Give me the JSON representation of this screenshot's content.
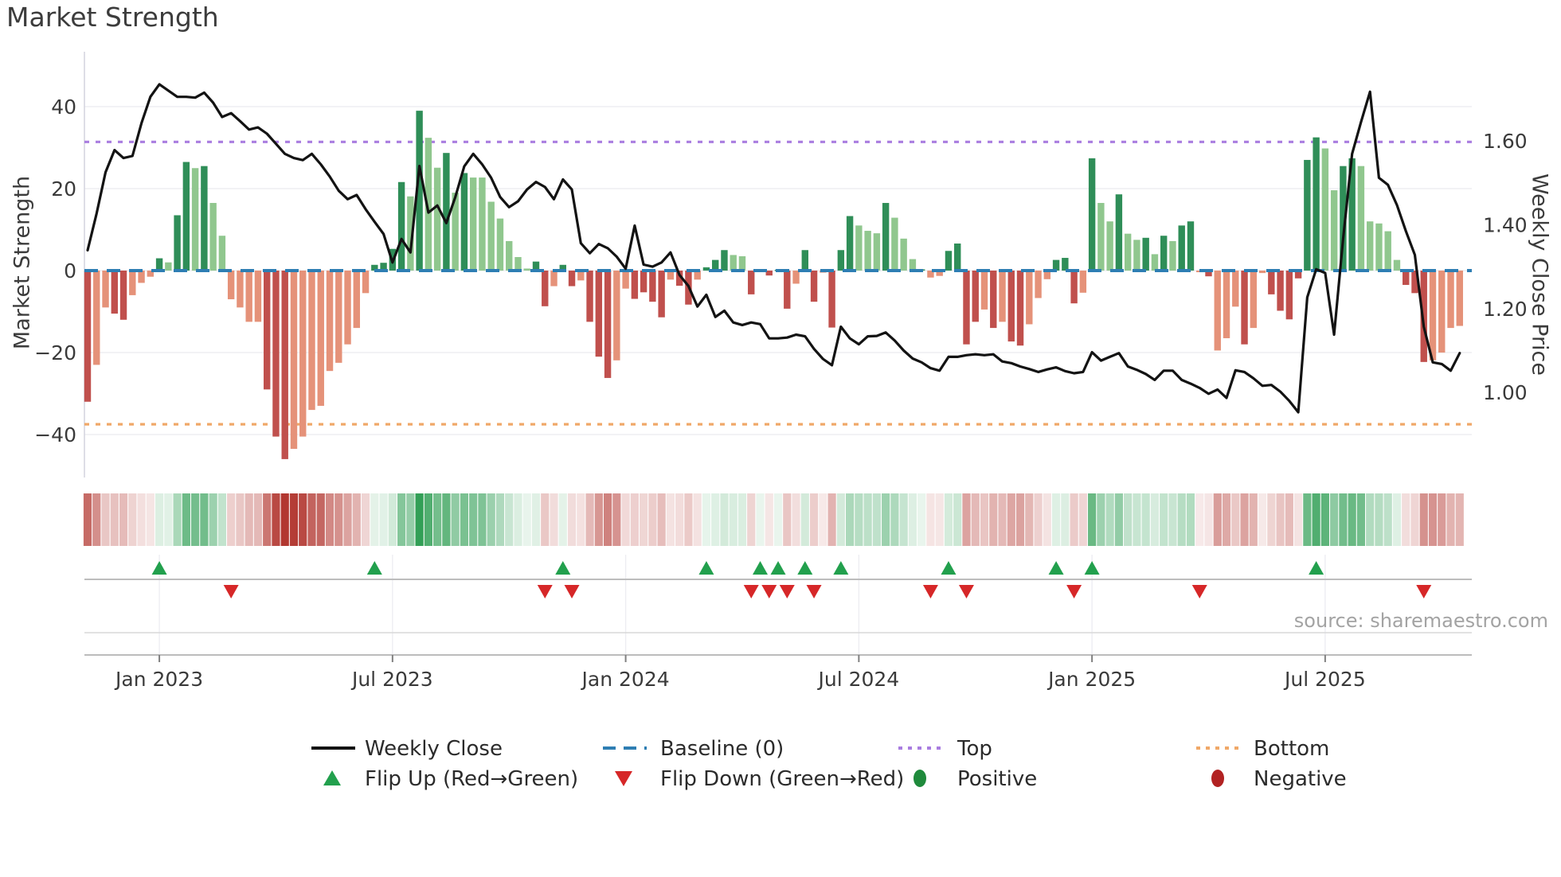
{
  "chart_data": {
    "type": "combo",
    "title": "Market Strength",
    "ylabel_left": "Market Strength",
    "ylabel_right": "Weekly Close Price",
    "source": "source: sharemaestro.com",
    "x_ticks": [
      {
        "label": "Jan 2023",
        "week": 8
      },
      {
        "label": "Jul 2023",
        "week": 34
      },
      {
        "label": "Jan 2024",
        "week": 60
      },
      {
        "label": "Jul 2024",
        "week": 86
      },
      {
        "label": "Jan 2025",
        "week": 112
      },
      {
        "label": "Jul 2025",
        "week": 138
      }
    ],
    "y_ticks_left": [
      {
        "label": "40",
        "value": 40
      },
      {
        "label": "20",
        "value": 20
      },
      {
        "label": "0",
        "value": 0
      },
      {
        "label": "−20",
        "value": -20
      },
      {
        "label": "−40",
        "value": -40
      }
    ],
    "y_ticks_right": [
      {
        "label": "1.60",
        "value": 1.6
      },
      {
        "label": "1.40",
        "value": 1.4
      },
      {
        "label": "1.20",
        "value": 1.2
      },
      {
        "label": "1.00",
        "value": 1.0
      }
    ],
    "reference_lines": {
      "baseline": {
        "label": "Baseline (0)",
        "value": 0
      },
      "top": {
        "label": "Top",
        "value": 31.4
      },
      "bottom": {
        "label": "Bottom",
        "value": -37.5
      }
    },
    "bars": {
      "name": "Market Strength (weekly)",
      "values": [
        -32,
        -23,
        -9,
        -10.5,
        -12,
        -6,
        -3,
        -1.5,
        3,
        2,
        13.5,
        26.5,
        25,
        25.5,
        16.5,
        8.5,
        -7,
        -9,
        -12.5,
        -12.5,
        -29,
        -40.5,
        -46,
        -43.5,
        -40.5,
        -34,
        -33,
        -24.5,
        -22.5,
        -18,
        -14,
        -5.5,
        1.4,
        1.9,
        5.3,
        21.6,
        18.1,
        39,
        32.4,
        25.1,
        28.7,
        19,
        23.8,
        22.7,
        22.7,
        16.8,
        12.7,
        7.2,
        3.3,
        0.5,
        2.2,
        -8.7,
        -3.8,
        1.4,
        -3.8,
        -2.4,
        -12.5,
        -21,
        -26.2,
        -21.9,
        -4.4,
        -6.9,
        -5.3,
        -7.6,
        -11.4,
        -2.2,
        -3.7,
        -8.3,
        -2.2,
        0.8,
        2.6,
        5,
        3.8,
        3.5,
        -5.8,
        0.2,
        -1.2,
        0.2,
        -9.3,
        -3.2,
        5,
        -7.6,
        -0.5,
        -13.9,
        5,
        13.3,
        11,
        9.7,
        9.1,
        16.5,
        12.9,
        7.8,
        2.8,
        0.3,
        -1.7,
        -1.3,
        4.8,
        6.6,
        -18,
        -12.5,
        -9.5,
        -14,
        -12.5,
        -17.3,
        -18.3,
        -13.1,
        -6.7,
        -2.1,
        2.6,
        3.1,
        -8,
        -5.4,
        27.4,
        16.5,
        12,
        18.6,
        9,
        7.5,
        8,
        4,
        8.5,
        7.2,
        11,
        12,
        -0.4,
        -1.4,
        -19.5,
        -16.5,
        -8.8,
        -18,
        -14,
        -0.6,
        -5.8,
        -9.8,
        -11.9,
        -1.9,
        27,
        32.5,
        29.8,
        19.6,
        25.5,
        27.4,
        25.5,
        12,
        11.5,
        9.6,
        2.6,
        -3.5,
        -5.5,
        -22.3,
        -21.9,
        -20,
        -14,
        -13.5
      ],
      "shade_rows": [
        "dllddllldl",
        "ddldllllll",
        "dddlllllll",
        "llddddldll",
        "dldlllllll",
        "ddlddldddl",
        "lddddlddld",
        "ddlldddddl",
        "ddldddllld",
        "llldlldddd",
        "ldlddllldd",
        "dldlldlldl",
        "dlddldllld",
        "llddddddll",
        "ddlllllddd",
        "llll"
      ]
    },
    "line": {
      "name": "Weekly Close",
      "prices": [
        1.339,
        1.427,
        1.525,
        1.578,
        1.559,
        1.564,
        1.642,
        1.705,
        1.735,
        1.72,
        1.705,
        1.705,
        1.703,
        1.715,
        1.691,
        1.657,
        1.666,
        1.647,
        1.627,
        1.632,
        1.617,
        1.593,
        1.569,
        1.559,
        1.554,
        1.569,
        1.544,
        1.515,
        1.481,
        1.461,
        1.471,
        1.437,
        1.407,
        1.378,
        1.31,
        1.366,
        1.334,
        1.54,
        1.429,
        1.446,
        1.404,
        1.466,
        1.539,
        1.569,
        1.544,
        1.512,
        1.466,
        1.442,
        1.456,
        1.484,
        1.502,
        1.49,
        1.461,
        1.508,
        1.484,
        1.356,
        1.332,
        1.354,
        1.344,
        1.324,
        1.295,
        1.398,
        1.305,
        1.3,
        1.31,
        1.334,
        1.28,
        1.254,
        1.205,
        1.233,
        1.18,
        1.195,
        1.167,
        1.161,
        1.167,
        1.163,
        1.129,
        1.129,
        1.131,
        1.138,
        1.134,
        1.104,
        1.08,
        1.065,
        1.157,
        1.129,
        1.115,
        1.134,
        1.135,
        1.143,
        1.124,
        1.1,
        1.081,
        1.072,
        1.058,
        1.052,
        1.085,
        1.085,
        1.089,
        1.091,
        1.089,
        1.091,
        1.074,
        1.07,
        1.062,
        1.056,
        1.049,
        1.055,
        1.06,
        1.051,
        1.046,
        1.049,
        1.096,
        1.076,
        1.085,
        1.094,
        1.062,
        1.054,
        1.044,
        1.03,
        1.052,
        1.052,
        1.03,
        1.021,
        1.011,
        0.997,
        1.007,
        0.987,
        1.053,
        1.049,
        1.034,
        1.016,
        1.018,
        1.002,
        0.98,
        0.953,
        1.227,
        1.294,
        1.285,
        1.138,
        1.366,
        1.569,
        1.645,
        1.717,
        1.512,
        1.495,
        1.447,
        1.385,
        1.328,
        1.157,
        1.072,
        1.068,
        1.052,
        1.094
      ]
    },
    "markers": {
      "flip_up_weeks": [
        8,
        32,
        53,
        69,
        75,
        77,
        80,
        84,
        96,
        108,
        112,
        137
      ],
      "flip_down_weeks": [
        16,
        51,
        54,
        74,
        76,
        78,
        81,
        94,
        98,
        110,
        124,
        149
      ]
    },
    "legend": {
      "row1": [
        {
          "label": "Weekly Close",
          "swatch": "line"
        },
        {
          "label": "Baseline (0)",
          "swatch": "dashed"
        },
        {
          "label": "Top",
          "swatch": "dotted-purple"
        },
        {
          "label": "Bottom",
          "swatch": "dotted-orange"
        }
      ],
      "row2": [
        {
          "label": "Flip Up (Red→Green)",
          "swatch": "triangle-up"
        },
        {
          "label": "Flip Down (Green→Red)",
          "swatch": "triangle-down"
        },
        {
          "label": "Positive",
          "swatch": "dot-green"
        },
        {
          "label": "Negative",
          "swatch": "dot-darkred"
        }
      ]
    },
    "colors": {
      "bar_pos_dark": "#2f8e58",
      "bar_pos_light": "#90c78e",
      "bar_neg_dark": "#c0504d",
      "bar_neg_light": "#e59279",
      "line": "#131313",
      "baseline": "#2e7eb3",
      "top": "#a97de0",
      "bottom": "#f0a868",
      "flip_up": "#22a04d",
      "flip_down": "#d62728",
      "positive_dot": "#1f8a3c",
      "negative_dot": "#b22222",
      "heat_pos": "#2f9e54",
      "heat_neg": "#b23730",
      "grid": "#ededf2",
      "spine": "#d4d4de",
      "tick_text": "#3a3a3a"
    }
  }
}
